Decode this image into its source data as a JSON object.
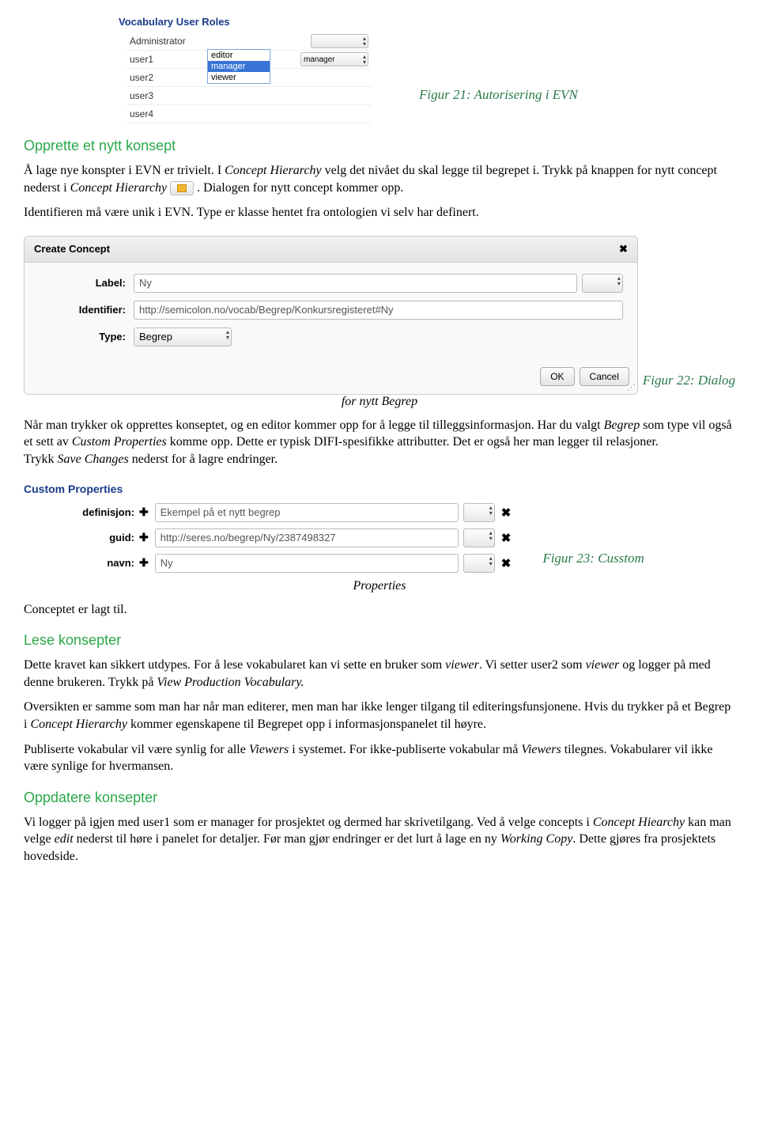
{
  "fig21": {
    "title": "Vocabulary User Roles",
    "rows": [
      {
        "name": "Administrator",
        "sel": ""
      },
      {
        "name": "user1",
        "sel": "manager"
      },
      {
        "name": "user2",
        "sel": ""
      },
      {
        "name": "user3",
        "sel": ""
      },
      {
        "name": "user4",
        "sel": ""
      }
    ],
    "popup": [
      "editor",
      "manager",
      "viewer"
    ],
    "caption": "Figur 21: Autorisering i EVN"
  },
  "sec1": {
    "heading": "Opprette et nytt konsept",
    "p1a": "Å lage nye konspter i EVN er trivielt. I ",
    "p1b": "Concept Hierarchy",
    "p1c": " velg det nivået du skal legge til begrepet i. Trykk på knappen for nytt concept nederst i ",
    "p1d": "Concept Hierarchy",
    "p1e": " . Dialogen for nytt concept kommer opp.",
    "p2": "Identifieren må være unik i EVN. Type er klasse hentet fra ontologien vi selv har definert."
  },
  "fig22": {
    "dialogTitle": "Create Concept",
    "labelLabel": "Label:",
    "labelValue": "Ny",
    "identLabel": "Identifier:",
    "identValue": "http://semicolon.no/vocab/Begrep/Konkursregisteret#Ny",
    "typeLabel": "Type:",
    "typeValue": "Begrep",
    "ok": "OK",
    "cancel": "Cancel",
    "close": "✖",
    "caption": "Figur 22: Dialog",
    "centerText": "for nytt Begrep"
  },
  "sec2": {
    "p1a": "Når man trykker ok opprettes konseptet, og en editor kommer opp for å legge til tilleggsinformasjon. Har du valgt ",
    "p1b": "Begrep",
    "p1c": " som type vil også  et sett av ",
    "p1d": "Custom Properties",
    "p1e": " komme opp. Dette er typisk DIFI-spesifikke attributter. Det er også her man legger til relasjoner.",
    "p2a": "Trykk ",
    "p2b": "Save Changes",
    "p2c": " nederst for å lagre endringer."
  },
  "fig23": {
    "title": "Custom Properties",
    "rows": [
      {
        "label": "definisjon:",
        "value": "Ekempel på et nytt begrep"
      },
      {
        "label": "guid:",
        "value": "http://seres.no/begrep/Ny/2387498327"
      },
      {
        "label": "navn:",
        "value": "Ny"
      }
    ],
    "plus": "✚",
    "x": "✖",
    "caption": "Figur 23: Cusstom",
    "centerText": "Properties",
    "after": "Conceptet er lagt til."
  },
  "sec3": {
    "heading": "Lese konsepter",
    "p1a": "Dette kravet kan sikkert utdypes. For å lese vokabularet kan vi sette en bruker som ",
    "p1b": "viewer",
    "p1c": ". Vi setter user2 som ",
    "p1d": "viewer",
    "p1e": " og logger på med denne brukeren. Trykk på ",
    "p1f": "View Production Vocabulary.",
    "p2a": "Oversikten er samme som man har når man editerer, men man har ikke lenger tilgang til editeringsfunsjonene. Hvis du trykker på et Begrep i ",
    "p2b": "Concept Hierarchy",
    "p2c": " kommer egenskapene til Begrepet opp i informasjonspanelet til høyre.",
    "p3a": "Publiserte vokabular vil være synlig for alle ",
    "p3b": "Viewers",
    "p3c": " i systemet. For ikke-publiserte vokabular må ",
    "p3d": "Viewers",
    "p3e": " tilegnes. Vokabularer vil ikke være synlige for hvermansen."
  },
  "sec4": {
    "heading": "Oppdatere konsepter",
    "p1a": "Vi logger på igjen med user1 som er manager for prosjektet og dermed har skrivetilgang. Ved å velge concepts i ",
    "p1b": "Concept Hiearchy",
    "p1c": " kan man velge ",
    "p1d": "edit",
    "p1e": " nederst til høre i panelet for detaljer. Før man gjør endringer er det lurt å lage en ny ",
    "p1f": "Working Copy",
    "p1g": ". Dette gjøres fra prosjektets hovedside."
  }
}
